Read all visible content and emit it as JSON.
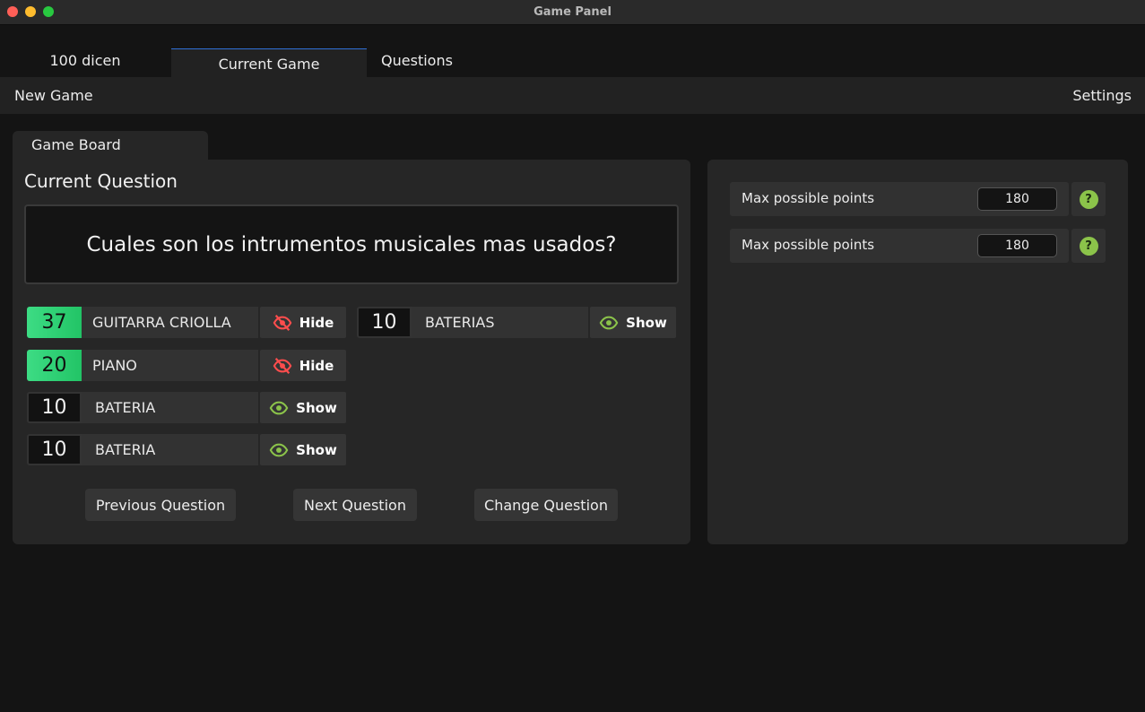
{
  "window": {
    "title": "Game Panel"
  },
  "tabs": [
    {
      "label": "100 dicen",
      "active": false
    },
    {
      "label": "Current Game",
      "active": true
    },
    {
      "label": "Questions",
      "active": false
    }
  ],
  "menu": {
    "new_game": "New Game",
    "settings": "Settings"
  },
  "board": {
    "tab_label": "Game Board",
    "current_question_label": "Current Question",
    "question": "Cuales son los intrumentos musicales mas usados?",
    "answers": [
      {
        "points": "37",
        "text": "GUITARRA CRIOLLA",
        "revealed": true,
        "button": "Hide",
        "icon": "eye-slash-icon"
      },
      {
        "points": "20",
        "text": "PIANO",
        "revealed": true,
        "button": "Hide",
        "icon": "eye-slash-icon"
      },
      {
        "points": "10",
        "text": "BATERIA",
        "revealed": false,
        "button": "Show",
        "icon": "eye-icon"
      },
      {
        "points": "10",
        "text": "BATERIA",
        "revealed": false,
        "button": "Show",
        "icon": "eye-icon"
      },
      {
        "points": "10",
        "text": "BATERIAS",
        "revealed": false,
        "button": "Show",
        "icon": "eye-icon"
      }
    ],
    "buttons": {
      "previous": "Previous Question",
      "next": "Next Question",
      "change": "Change Question"
    }
  },
  "settings_panel": {
    "rows": [
      {
        "label": "Max possible points",
        "value": "180",
        "help": "?"
      },
      {
        "label": "Max possible points",
        "value": "180",
        "help": "?"
      }
    ]
  },
  "colors": {
    "revealed": "#3ddc84",
    "hide_icon": "#ff4d4d",
    "show_icon": "#8bc34a",
    "help": "#8bc34a",
    "active_tab_accent": "#2f6fd6"
  }
}
